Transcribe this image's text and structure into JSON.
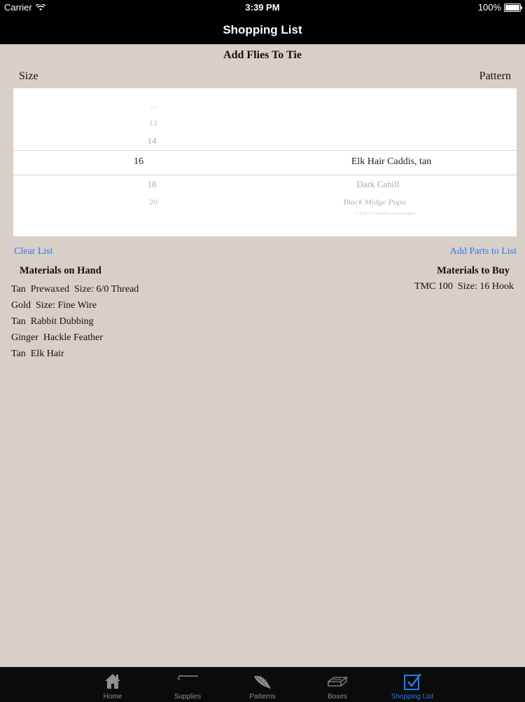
{
  "status_bar": {
    "carrier": "Carrier",
    "time": "3:39 PM",
    "battery": "100%"
  },
  "nav": {
    "title": "Shopping List"
  },
  "add_flies": {
    "title": "Add Flies To Tie",
    "size_label": "Size",
    "pattern_label": "Pattern",
    "picker": {
      "sizes": [
        "10",
        "12",
        "14",
        "16",
        "18",
        "20"
      ],
      "patterns": [
        "Elk Hair Caddis, tan",
        "Dark Cahill",
        "Black Midge Pupa",
        "CDC Caddis Emerger"
      ],
      "selected_size": "16",
      "selected_pattern": "Elk Hair Caddis, tan"
    }
  },
  "actions": {
    "clear_list": "Clear List",
    "add_parts": "Add Parts to List"
  },
  "materials_on_hand": {
    "title": "Materials on Hand",
    "items": [
      "Tan  Prewaxed  Size: 6/0 Thread",
      "Gold  Size: Fine Wire",
      "Tan  Rabbit Dubbing",
      "Ginger  Hackle Feather",
      "Tan  Elk Hair"
    ]
  },
  "materials_to_buy": {
    "title": "Materials to Buy",
    "items": [
      "TMC 100  Size: 16 Hook"
    ]
  },
  "tab_bar": {
    "tabs": [
      {
        "label": "Home",
        "icon": "home-icon"
      },
      {
        "label": "Supplies",
        "icon": "supplies-icon"
      },
      {
        "label": "Patterns",
        "icon": "patterns-icon"
      },
      {
        "label": "Boxes",
        "icon": "boxes-icon"
      },
      {
        "label": "Shopping List",
        "icon": "checkbox-icon"
      }
    ],
    "active": "Shopping List"
  },
  "colors": {
    "background": "#d9cfc9",
    "accent": "#2f7be6",
    "bar": "#000000"
  }
}
